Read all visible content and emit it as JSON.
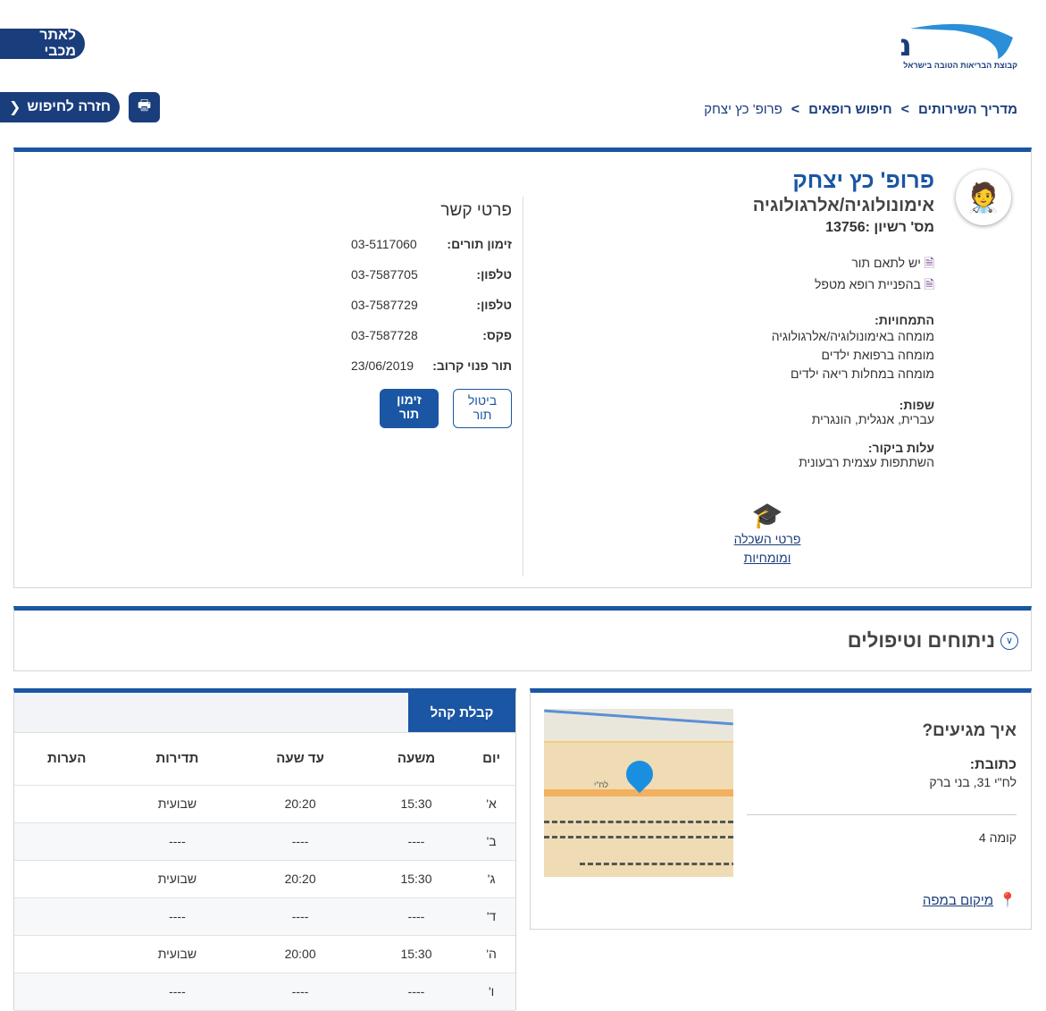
{
  "logo": {
    "name": "מכבי",
    "tagline": "קבוצת הבריאות הטובה בישראל"
  },
  "header": {
    "site_button": "לאתר מכבי",
    "back_button": "חזרה לחיפוש"
  },
  "breadcrumb": [
    "מדריך השירותים",
    "חיפוש רופאים",
    "פרופ' כץ יצחק"
  ],
  "breadcrumb_sep": ">",
  "doctor": {
    "name": "פרופ' כץ יצחק",
    "specialty": "אימונולוגיה/אלרגולוגיה",
    "license": "מס' רשיון :13756",
    "notes": [
      "יש לתאם תור",
      "בהפניית רופא מטפל"
    ],
    "expertise_title": "התמחויות:",
    "expertise": [
      "מומחה באימונולוגיה/אלרגולוגיה",
      "מומחה ברפואת ילדים",
      "מומחה במחלות ריאה ילדים"
    ],
    "languages_title": "שפות:",
    "languages": "עברית, אנגלית, הונגרית",
    "cost_title": "עלות ביקור:",
    "cost": "השתתפות עצמית רבעונית",
    "education_link": "פרטי השכלה ומומחיות"
  },
  "contact": {
    "title": "פרטי קשר",
    "rows": [
      {
        "label": "זימון תורים:",
        "value": "03-5117060"
      },
      {
        "label": "טלפון:",
        "value": "03-7587705"
      },
      {
        "label": "טלפון:",
        "value": "03-7587729"
      },
      {
        "label": "פקס:",
        "value": "03-7587728"
      },
      {
        "label": "תור פנוי קרוב:",
        "value": "23/06/2019"
      }
    ],
    "cancel_button": "ביטול תור",
    "book_button": "זימון תור"
  },
  "treatments": {
    "title": "ניתוחים וטיפולים"
  },
  "location": {
    "title": "איך מגיעים?",
    "address_label": "כתובת:",
    "address": "לח\"י 31, בני ברק",
    "floor": "קומה 4",
    "map_link": "מיקום במפה",
    "map_street": "לח\"י"
  },
  "hours": {
    "tab": "קבלת קהל",
    "headers": [
      "יום",
      "משעה",
      "עד שעה",
      "תדירות",
      "הערות"
    ],
    "rows": [
      [
        "א'",
        "15:30",
        "20:20",
        "שבועית",
        ""
      ],
      [
        "ב'",
        "----",
        "----",
        "----",
        ""
      ],
      [
        "ג'",
        "15:30",
        "20:20",
        "שבועית",
        ""
      ],
      [
        "ד'",
        "----",
        "----",
        "----",
        ""
      ],
      [
        "ה'",
        "15:30",
        "20:00",
        "שבועית",
        ""
      ],
      [
        "ו'",
        "----",
        "----",
        "----",
        ""
      ]
    ]
  }
}
